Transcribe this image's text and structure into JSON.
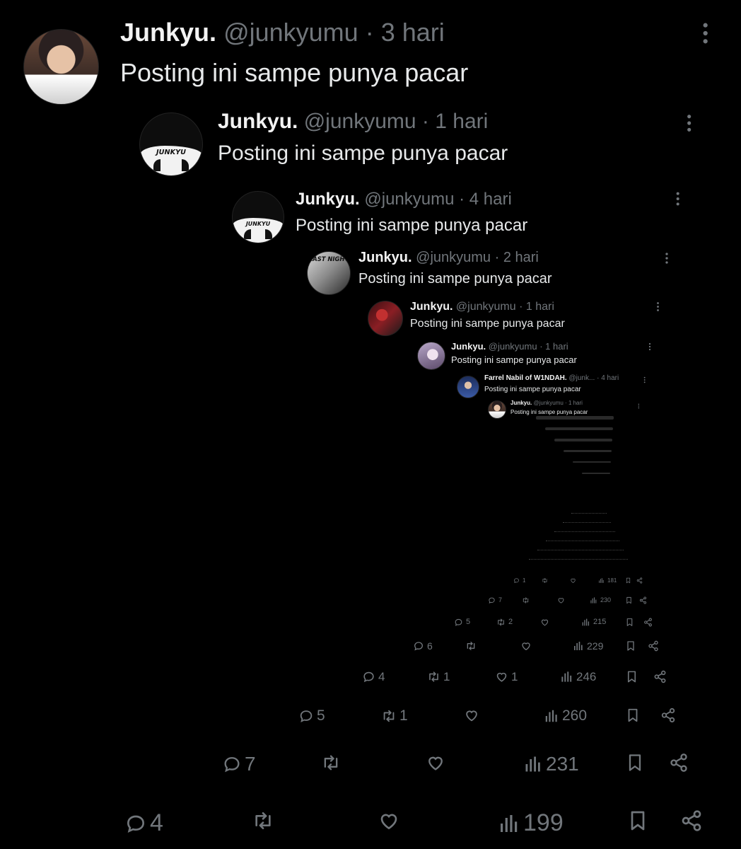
{
  "posts": [
    {
      "name": "Junkyu.",
      "handle": "@junkyumu",
      "time": "3 hari",
      "text": "Posting ini sampe punya pacar",
      "replies": "4",
      "reposts": "",
      "likes": "",
      "views": "199"
    },
    {
      "name": "Junkyu.",
      "handle": "@junkyumu",
      "time": "1 hari",
      "text": "Posting ini sampe punya pacar",
      "replies": "7",
      "reposts": "",
      "likes": "",
      "views": "231"
    },
    {
      "name": "Junkyu.",
      "handle": "@junkyumu",
      "time": "4 hari",
      "text": "Posting ini sampe punya pacar",
      "replies": "5",
      "reposts": "1",
      "likes": "",
      "views": "260"
    },
    {
      "name": "Junkyu.",
      "handle": "@junkyumu",
      "time": "2 hari",
      "text": "Posting ini sampe punya pacar",
      "replies": "4",
      "reposts": "1",
      "likes": "1",
      "views": "246"
    },
    {
      "name": "Junkyu.",
      "handle": "@junkyumu",
      "time": "1 hari",
      "text": "Posting ini sampe punya pacar",
      "replies": "6",
      "reposts": "",
      "likes": "",
      "views": "229"
    },
    {
      "name": "Junkyu.",
      "handle": "@junkyumu",
      "time": "1 hari",
      "text": "Posting ini sampe punya pacar",
      "replies": "5",
      "reposts": "2",
      "likes": "",
      "views": "215"
    },
    {
      "name": "Farrel Nabil of W1NDAH.",
      "handle": "@junk...",
      "time": "4 hari",
      "text": "Posting ini sampe punya pacar",
      "replies": "7",
      "reposts": "",
      "likes": "",
      "views": "230"
    },
    {
      "name": "Junkyu.",
      "handle": "@junkyumu",
      "time": "1 hari",
      "text": "Posting ini sampe punya pacar",
      "replies": "1",
      "reposts": "",
      "likes": "",
      "views": "181"
    }
  ],
  "avatar_labels": {
    "jersey": "JUNKYU",
    "poster": "LAST NIGHT"
  },
  "icons": {
    "reply": "reply-icon",
    "repost": "repost-icon",
    "like": "heart-icon",
    "views": "views-icon",
    "bookmark": "bookmark-icon",
    "share": "share-icon",
    "more": "more-icon"
  },
  "colors": {
    "background": "#000000",
    "text": "#e7e9ea",
    "muted": "#71767b"
  }
}
